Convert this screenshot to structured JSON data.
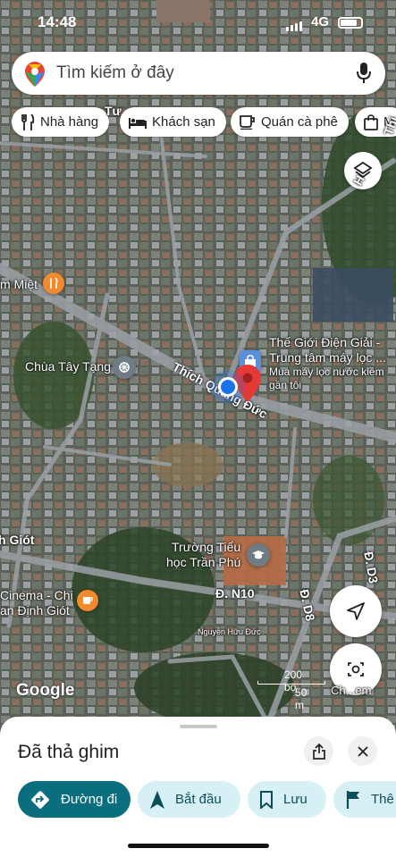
{
  "status": {
    "time": "14:48",
    "network": "4G"
  },
  "search": {
    "placeholder": "Tìm kiếm ở đây"
  },
  "chips": [
    {
      "label": "Nhà hàng",
      "icon": "fork-knife-icon"
    },
    {
      "label": "Khách sạn",
      "icon": "bed-icon"
    },
    {
      "label": "Quán cà phê",
      "icon": "coffee-cup-icon"
    },
    {
      "label": "M",
      "icon": "shopping-bag-icon"
    }
  ],
  "map": {
    "streets": {
      "thich_quang_duc": "Thích Quảng Đức",
      "n10": "Đ. N10",
      "d8": "Đ. D8",
      "d3": "Đ. D3",
      "h_label": "H",
      "thi_label": "Thi",
      "tu_label": "Tư",
      "giot": "h Giót",
      "miet": "m Miệt"
    },
    "places": {
      "chua": "Chùa Tây Tạng",
      "truong_line1": "Trường Tiểu",
      "truong_line2": "học Trần Phú",
      "cinema_line1": "Cinema - Chi",
      "cinema_line2": "an Định Giót",
      "nguyen": "Nguyễn Hữu Đức",
      "pin_line1": "Thế Giới Điện Giải -",
      "pin_line2": "Trung tâm máy lọc ...",
      "pin_sub1": "Mua máy lọc nước kiềm",
      "pin_sub2": "gần tôi"
    },
    "logo": "Google",
    "scale": {
      "feet": "200 bộ",
      "meters": "50 m"
    },
    "chat_label": "Ch...em"
  },
  "sheet": {
    "title": "Đã thả ghim",
    "actions": [
      {
        "label": "Đường đi",
        "icon": "directions-icon",
        "style": "primary"
      },
      {
        "label": "Bắt đầu",
        "icon": "navigation-arrow-icon",
        "style": "secondary"
      },
      {
        "label": "Lưu",
        "icon": "bookmark-icon",
        "style": "secondary"
      },
      {
        "label": "Thê",
        "icon": "flag-icon",
        "style": "secondary"
      }
    ]
  },
  "colors": {
    "primary": "#0b6e7e",
    "secondary_bg": "#d7f0f6",
    "pin_red": "#e53935",
    "location_blue": "#1a73e8"
  }
}
